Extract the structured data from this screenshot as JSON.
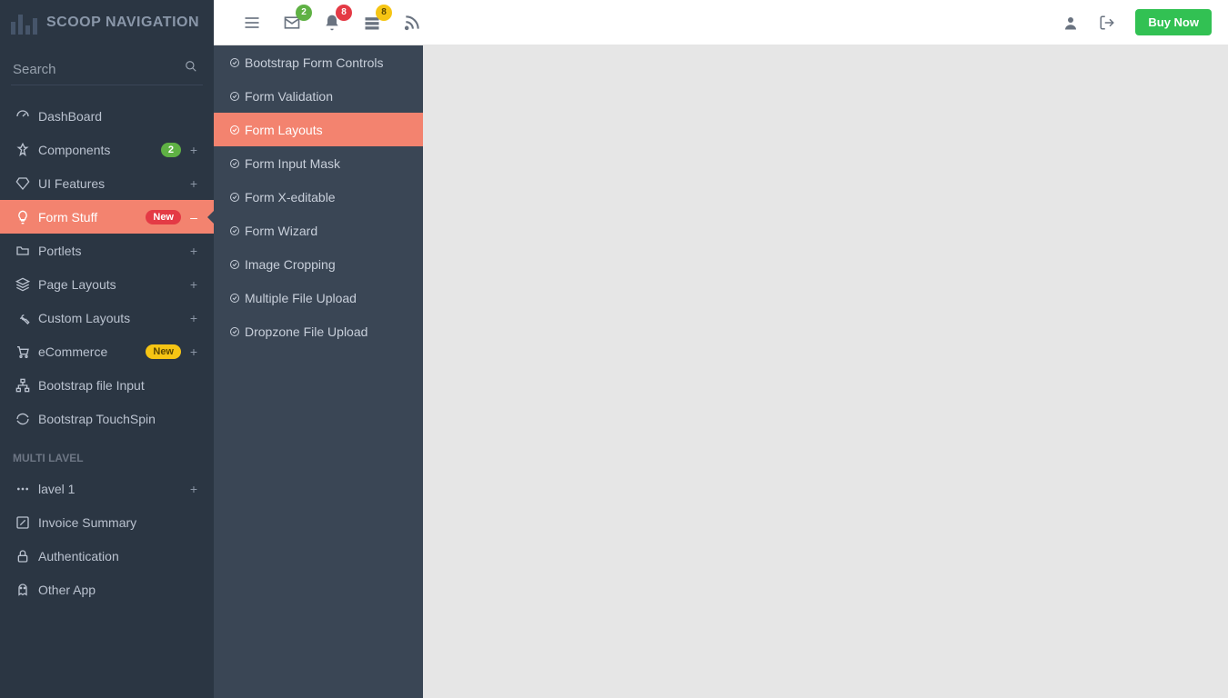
{
  "brand": {
    "title": "SCOOP NAVIGATION"
  },
  "search": {
    "placeholder": "Search"
  },
  "sidebar": {
    "items": [
      {
        "label": "DashBoard"
      },
      {
        "label": "Components",
        "badge": "2"
      },
      {
        "label": "UI Features"
      },
      {
        "label": "Form Stuff",
        "badge": "New"
      },
      {
        "label": "Portlets"
      },
      {
        "label": "Page Layouts"
      },
      {
        "label": "Custom Layouts"
      },
      {
        "label": "eCommerce",
        "badge": "New"
      },
      {
        "label": "Bootstrap file Input"
      },
      {
        "label": "Bootstrap TouchSpin"
      }
    ],
    "section_header": "MULTI LAVEL",
    "more": [
      {
        "label": "lavel 1"
      },
      {
        "label": "Invoice Summary"
      },
      {
        "label": "Authentication"
      },
      {
        "label": "Other App"
      }
    ]
  },
  "submenu": {
    "items": [
      {
        "label": "Bootstrap Form Controls"
      },
      {
        "label": "Form Validation"
      },
      {
        "label": "Form Layouts"
      },
      {
        "label": "Form Input Mask"
      },
      {
        "label": "Form X-editable"
      },
      {
        "label": "Form Wizard"
      },
      {
        "label": "Image Cropping"
      },
      {
        "label": "Multiple File Upload"
      },
      {
        "label": "Dropzone File Upload"
      }
    ]
  },
  "topbar": {
    "badges": {
      "mail": "2",
      "bell": "8",
      "inbox": "8"
    },
    "buy": "Buy Now"
  }
}
